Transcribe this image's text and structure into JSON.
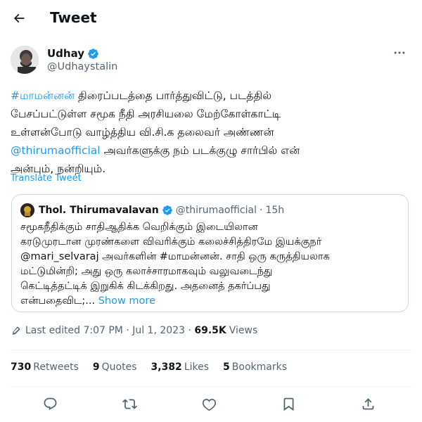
{
  "header": {
    "title": "Tweet"
  },
  "author": {
    "name": "Udhay",
    "handle": "@Udhaystalin"
  },
  "tweet": {
    "lines": [
      {
        "hashtag": "#மாமன்னன்",
        "text": " திரைப்படத்தை பார்த்துவிட்டு, படத்தில்"
      },
      {
        "text": "பேசப்பட்டுள்ள சமூக நீதி அரசியலை மேற்கோள்காட்டி"
      },
      {
        "text": "உள்ளன்போடு வாழ்த்திய வி.சி.க தலைவர் அண்ணன்"
      },
      {
        "mention": "@thirumaofficial",
        "text": " அவர்களுக்கு நம் படக்குழு சார்பில் என்"
      },
      {
        "text": "அன்பும், நன்றியும்."
      }
    ],
    "translate_label": "Translate Tweet"
  },
  "quote": {
    "name": "Thol. Thirumavalavan",
    "handle": "@thirumaofficial",
    "separator": "·",
    "time": "15h",
    "lines": [
      "சமூகநீதிக்கும் சாதிஆதிக்க வெறிக்கும் இடையிலான",
      "கரடுமுரடான முரண்களை விவரிக்கும் கலைச்சித்திரமே இயக்குநர்",
      "@mari_selvaraj அவர்களின்  #மாமன்னன். சாதி ஒரு கருத்தியலாக",
      "மட்டுமின்றி; அது ஒரு கலாச்சாரமாகவும் வலுவடைந்து",
      "கெட்டித்தட்டிக் இறுகிக் கிடக்கிறது. அதனைத் தகர்ப்பது",
      "என்பதைவிட;..."
    ],
    "show_more": "Show more"
  },
  "meta": {
    "edited": "Last edited 7:07 PM",
    "sep": " · ",
    "date": "Jul 1, 2023",
    "views_count": "69.5K",
    "views_label": "Views"
  },
  "stats": [
    {
      "count": "730",
      "label": "Retweets"
    },
    {
      "count": "9",
      "label": "Quotes"
    },
    {
      "count": "3,382",
      "label": "Likes"
    },
    {
      "count": "5",
      "label": "Bookmarks"
    }
  ],
  "icons": {
    "back": "back-arrow-icon",
    "verified": "verified-badge-icon",
    "more": "more-dots-icon",
    "edit": "edit-pencil-icon",
    "reply": "reply-icon",
    "retweet": "retweet-icon",
    "like": "like-heart-icon",
    "bookmark": "bookmark-icon",
    "share": "share-icon"
  },
  "colors": {
    "accent": "#1d9bf0",
    "text": "#0f1419",
    "muted": "#536471",
    "border": "#cfd9de"
  }
}
